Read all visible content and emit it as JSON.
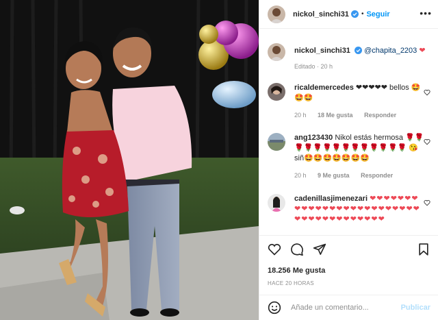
{
  "colors": {
    "accent": "#0095f6",
    "heart": "#ed4956",
    "meta": "#8e8e8e",
    "mention": "#00376b"
  },
  "header": {
    "username": "nickol_sinchi31",
    "separator": "•",
    "follow_label": "Seguir",
    "more_icon": "more-dots-icon"
  },
  "caption": {
    "username": "nickol_sinchi31",
    "mention": "@chapita_2203",
    "emoji": "❤",
    "meta": "Editado · 20 h"
  },
  "comments": [
    {
      "username": "ricaldemercedes",
      "text": "❤❤❤❤❤ bellos 🤩🤩🤩",
      "time": "20 h",
      "likes": "18 Me gusta",
      "reply": "Responder"
    },
    {
      "username": "ang123430",
      "text": "Nikol estás hermosa 🌹🌹🌹🌹🌹🌹🌹🌹🌹🌹🌹🌹🌹🌹 😘 siñ🤩🤩🤩🤩🤩🤩🤩",
      "time": "20 h",
      "likes": "9 Me gusta",
      "reply": "Responder"
    },
    {
      "username": "cadenillasjimenezari",
      "text": "❤❤❤❤❤❤❤❤❤❤❤❤❤❤❤❤❤❤❤❤❤❤❤❤❤❤❤❤❤❤❤❤❤❤❤❤❤❤"
    }
  ],
  "actions": {
    "likes": "18.256 Me gusta",
    "time": "HACE 20 HORAS"
  },
  "add_comment": {
    "placeholder": "Añade un comentario...",
    "publish": "Publicar"
  }
}
